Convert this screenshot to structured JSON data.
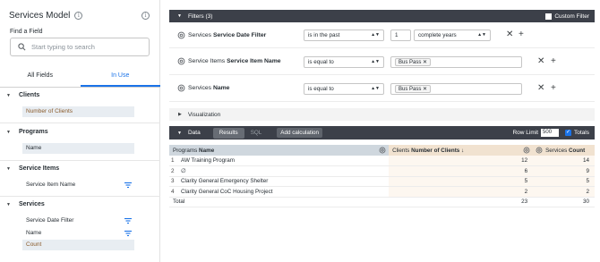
{
  "sidebar": {
    "title": "Services Model",
    "find_label": "Find a Field",
    "search_placeholder": "Start typing to search",
    "tabs": [
      "All Fields",
      "In Use"
    ],
    "views": [
      {
        "name": "Clients",
        "fields": [
          "Number of Clients"
        ]
      },
      {
        "name": "Programs",
        "fields": [
          "Name"
        ]
      },
      {
        "name": "Service Items",
        "fields": [
          "Service Item Name"
        ]
      },
      {
        "name": "Services",
        "fields": [
          "Service Date Filter",
          "Name",
          "Count"
        ]
      }
    ]
  },
  "filters": {
    "header": "Filters (3)",
    "custom_filter": "Custom Filter",
    "rows": [
      {
        "view": "Services",
        "field": "Service Date Filter",
        "operator": "is in the past",
        "value": "1",
        "unit": "complete years"
      },
      {
        "view": "Service Items",
        "field": "Service Item Name",
        "operator": "is equal to",
        "chip": "Bus Pass"
      },
      {
        "view": "Services",
        "field": "Name",
        "operator": "is equal to",
        "chip": "Bus Pass"
      }
    ]
  },
  "visualization_label": "Visualization",
  "data_bar": {
    "label": "Data",
    "tabs": [
      "Results",
      "SQL"
    ],
    "add_calc": "Add calculation",
    "row_limit_label": "Row Limit",
    "row_limit_value": "500",
    "totals_label": "Totals"
  },
  "results": {
    "headers": [
      {
        "view": "Programs",
        "field": "Name"
      },
      {
        "view": "Clients",
        "field": "Number of Clients ↓"
      },
      {
        "view": "Services",
        "field": "Count"
      }
    ],
    "rows": [
      {
        "n": "1",
        "name": "AW Training Program",
        "clients": "12",
        "count": "14"
      },
      {
        "n": "2",
        "name": "∅",
        "clients": "6",
        "count": "9"
      },
      {
        "n": "3",
        "name": "Clarity General Emergency Shelter",
        "clients": "5",
        "count": "5"
      },
      {
        "n": "4",
        "name": "Clarity General CoC Housing Project",
        "clients": "2",
        "count": "2"
      }
    ],
    "total": {
      "label": "Total",
      "clients": "23",
      "count": "30"
    }
  },
  "colors": {
    "header_bar": "#3c4049",
    "accent": "#1a73e8",
    "dimension": "#cfd7de",
    "measure": "#f1e2d0"
  }
}
